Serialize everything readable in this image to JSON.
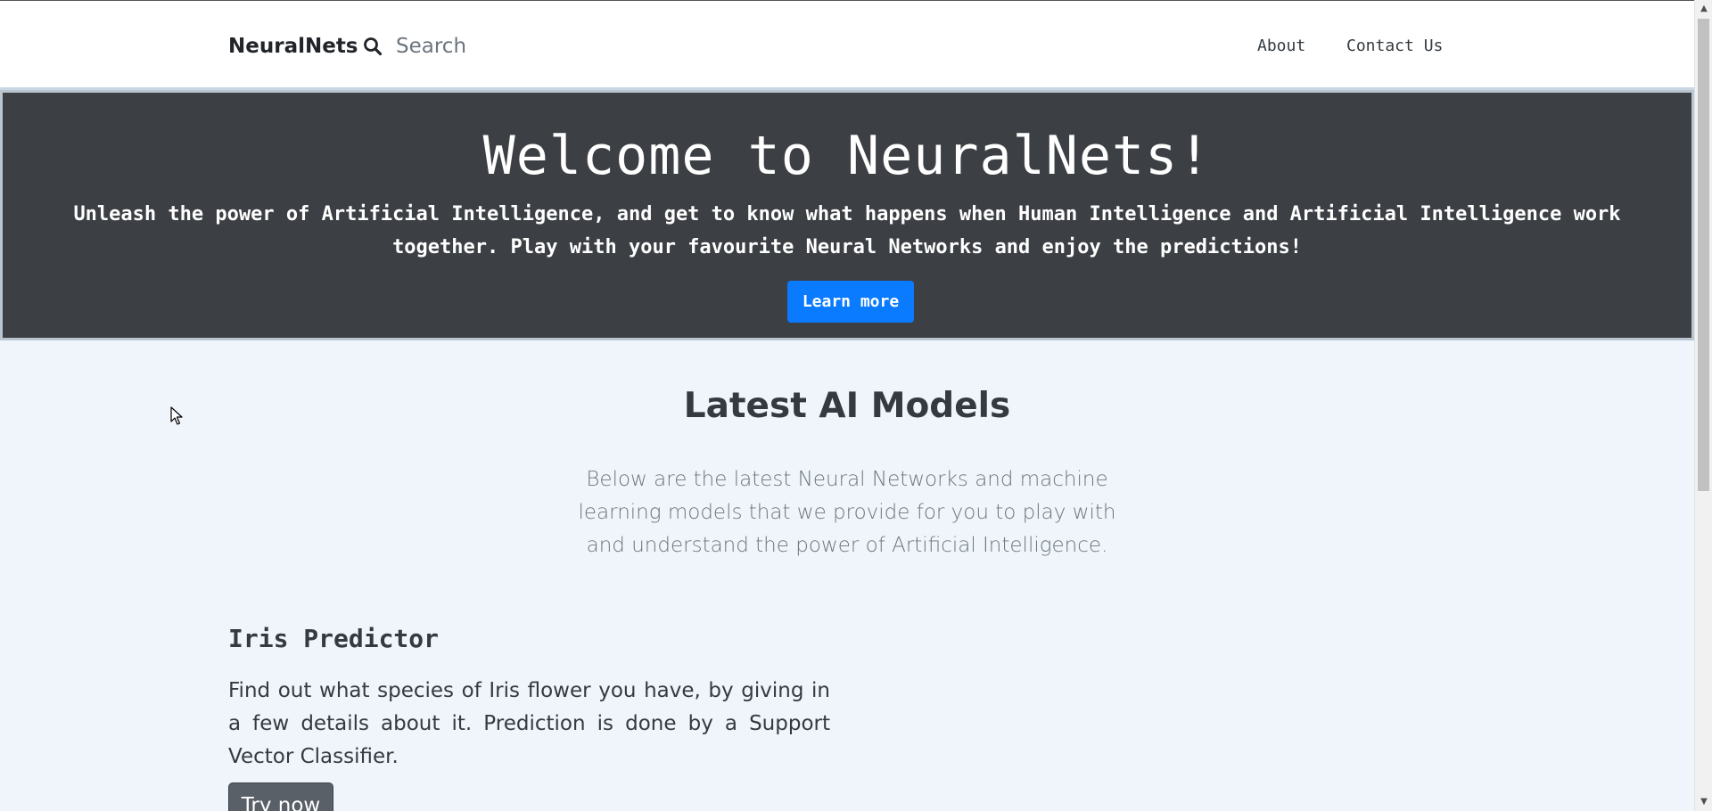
{
  "navbar": {
    "brand": "NeuralNets",
    "search": {
      "placeholder": "Search",
      "value": ""
    },
    "links": [
      "About",
      "Contact Us"
    ]
  },
  "hero": {
    "title": "Welcome to NeuralNets!",
    "text": "Unleash the power of Artificial Intelligence, and get to know what happens when Human Intelligence and Artificial Intelligence work together. Play with your favourite Neural Networks and enjoy the predictions!",
    "button_label": "Learn more"
  },
  "section": {
    "title": "Latest AI Models",
    "description": "Below are the latest Neural Networks and machine learning models that we provide for you to play with and understand the power of Artificial Intelligence."
  },
  "models": [
    {
      "title": "Iris Predictor",
      "description": "Find out what species of Iris flower you have, by giving in a few details about it. Prediction is done by a Support Vector Classifier.",
      "button_label": "Try now"
    }
  ],
  "colors": {
    "accent": "#0a7bff",
    "hero_bg": "#3c3f44",
    "page_bg": "#f0f5fb",
    "secondary_button": "#5a6068"
  },
  "icons": [
    "search-icon",
    "cursor-arrow-icon",
    "scroll-up-arrow-icon",
    "scroll-down-arrow-icon"
  ]
}
